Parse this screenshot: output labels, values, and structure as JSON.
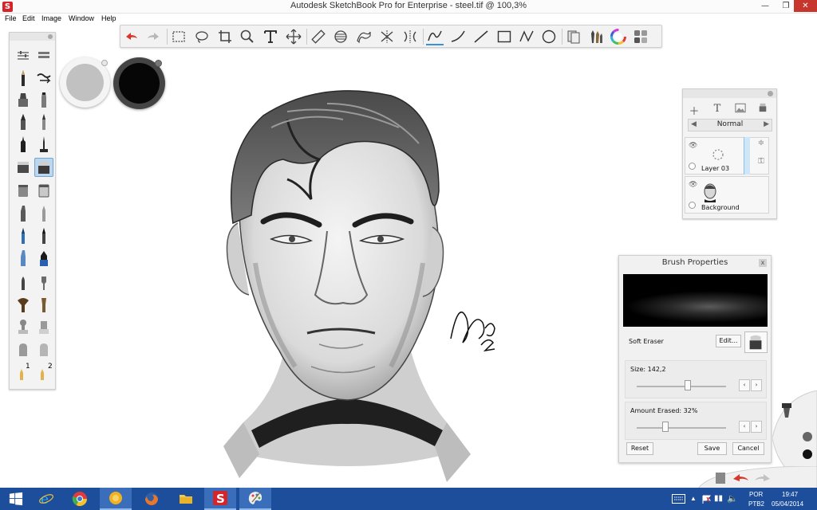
{
  "window": {
    "title": "Autodesk SketchBook Pro for Enterprise - steel.tif @ 100,3%"
  },
  "menu": [
    "File",
    "Edit",
    "Image",
    "Window",
    "Help"
  ],
  "toolbar": {
    "items": [
      "undo-icon",
      "redo-icon",
      "rect-select-icon",
      "lasso-select-icon",
      "crop-icon",
      "zoom-icon",
      "text-icon",
      "transform-icon",
      "ruler-icon",
      "ellipse-guide-icon",
      "french-curve-icon",
      "symmetry-x-icon",
      "symmetry-y-icon",
      "freehand-line-icon",
      "curve-icon",
      "straight-line-icon",
      "rectangle-icon",
      "polyline-icon",
      "ellipse-icon",
      "copic-library-icon",
      "brushes-icon",
      "color-wheel-icon",
      "swatches-icon"
    ],
    "active": "freehand-line-icon"
  },
  "brush_palette": {
    "numbers": [
      "1",
      "2"
    ],
    "selected": "soft-eraser"
  },
  "colors": {
    "active": "#c1c1c1",
    "secondary": "#060606",
    "accent": "#3a8fd8"
  },
  "layers": {
    "blend_mode": "Normal",
    "items": [
      {
        "name": "Layer 03"
      },
      {
        "name": "Background"
      }
    ]
  },
  "brush_properties": {
    "title": "Brush Properties",
    "close": "x",
    "brush_name": "Soft Eraser",
    "edit_label": "Edit...",
    "size_label": "Size: 142,2",
    "size_value": 142.2,
    "amount_label": "Amount Erased: 32%",
    "amount_value": 32,
    "step_left": "‹",
    "step_right": "›",
    "reset_label": "Reset",
    "save_label": "Save",
    "cancel_label": "Cancel"
  },
  "taskbar": {
    "apps": [
      "windows-start-icon",
      "internet-explorer-icon",
      "chrome-icon",
      "photo-viewer-icon",
      "firefox-icon",
      "file-explorer-icon",
      "sketchbook-icon",
      "paint-icon"
    ],
    "language": "POR",
    "layout": "PTB2",
    "time": "19:47",
    "date": "05/04/2014"
  }
}
